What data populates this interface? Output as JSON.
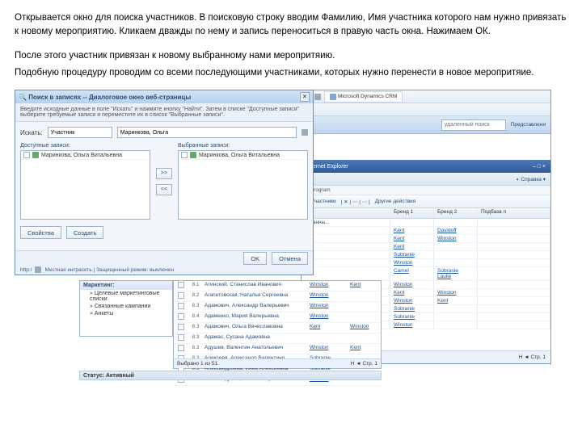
{
  "instructions": {
    "p1": "Открывается окно для поиска участников. В поисковую строку вводим Фамилию, Имя участника которого нам нужно привязать к новому мероприятию. Кликаем дважды по нему и запись переноситься в правую часть окна. Нажимаем ОК.",
    "p2": "После этого участник привязан к новому выбранному нами меропритяию.",
    "p3": "Подобную процедуру проводим со всеми последующими участниками, которых нужно перенести в новое меропритяие."
  },
  "dialog": {
    "title": "Поиск в записях -- Диалоговое окно веб-страницы",
    "hint": "Введите исходные данные в поле \"Искать\" и нажмите кнопку \"Найти\". Затем в списке \"Доступные записи\" выберите требуемые записи и переместите их в список \"Выбранные записи\".",
    "search_label": "Искать:",
    "entity_value": "Участник",
    "query_value": "Маринкова, Ольга",
    "avail_label": "Доступные записи:",
    "sel_label": "Выбранные записи:",
    "avail_item": "Маринкова, Ольга Витальевна",
    "sel_item": "Маринкова, Ольга Витальевна",
    "arrow_add": ">>",
    "arrow_rem": "<<",
    "btn_props": "Свойства",
    "btn_new": "Создать",
    "btn_ok": "OK",
    "btn_cancel": "Отмена",
    "status": "Местная интрасеть | Защищенный режим: выключен"
  },
  "crm": {
    "app": "Microsoft Dynamics CRM",
    "search_ph": "удаленный поиск",
    "present": "Представлени",
    "ie_title": "Internet Explorer",
    "help": "Справка",
    "program_label": "a program",
    "btn_parts": "Участники",
    "btn_other": "Другие действия",
    "headers": [
      "",
      "Бренд 1",
      "Бренд 2",
      "Подбаза п"
    ],
    "rows": [
      [
        "странны...",
        "",
        "",
        ""
      ],
      [
        "",
        "Kent",
        "Davidoff",
        ""
      ],
      [
        "",
        "Kent",
        "Winston",
        ""
      ],
      [
        "",
        "Kent",
        "",
        ""
      ],
      [
        "",
        "Sobranie",
        "",
        ""
      ],
      [
        "",
        "Winston",
        "",
        ""
      ],
      [
        "",
        "Camel",
        "Sobranie Laulie",
        ""
      ],
      [
        "",
        "Winston",
        "",
        ""
      ],
      [
        "",
        "Kent",
        "Winston",
        ""
      ],
      [
        "",
        "Winston",
        "Kent",
        ""
      ],
      [
        "",
        "Sobranie",
        "",
        ""
      ],
      [
        "",
        "Sobranie",
        "",
        ""
      ],
      [
        "",
        "Winston",
        "",
        ""
      ]
    ],
    "paging": "Стр. 1"
  },
  "tree": {
    "head": "Маркетинг:",
    "items": [
      "Целевые маркетинговые списки",
      "Связанные кампании",
      "Анкеты"
    ]
  },
  "midTable": {
    "rows": [
      [
        "8.1",
        "Атинский, Станислав Иванович",
        "Winston",
        "Kent"
      ],
      [
        "8.2",
        "Агапетовская, Наталья Сергеевна",
        "Winston",
        ""
      ],
      [
        "8.3",
        "Адамович, Александр Валерьевич",
        "Winston",
        ""
      ],
      [
        "8.4",
        "Адаменко, Мария Валерьевна",
        "Winston",
        ""
      ],
      [
        "8.3",
        "Адамович, Ольга Вячеславовна",
        "Kent",
        "Winston"
      ],
      [
        "8.3",
        "Адамас, Сусана Адамовна",
        "",
        ""
      ],
      [
        "8.3",
        "Адушев, Валентин Анатольевич",
        "Winston",
        "Kent"
      ],
      [
        "8.3",
        "Алексеев, Александр Валентино...",
        "Sobranie",
        ""
      ],
      [
        "8.3",
        "Александровна, Инна Алексеевна",
        "Sobranie",
        ""
      ],
      [
        "8.3",
        "Александрова, Инна Валерьевна",
        "Winston",
        ""
      ]
    ],
    "footer_left": "Выбрано 1 из 51.",
    "footer_right": "Н ◄ Стр. 1"
  },
  "statusbar": "Статус: Активный",
  "winctl": "– □ ×",
  "http": "http:/"
}
